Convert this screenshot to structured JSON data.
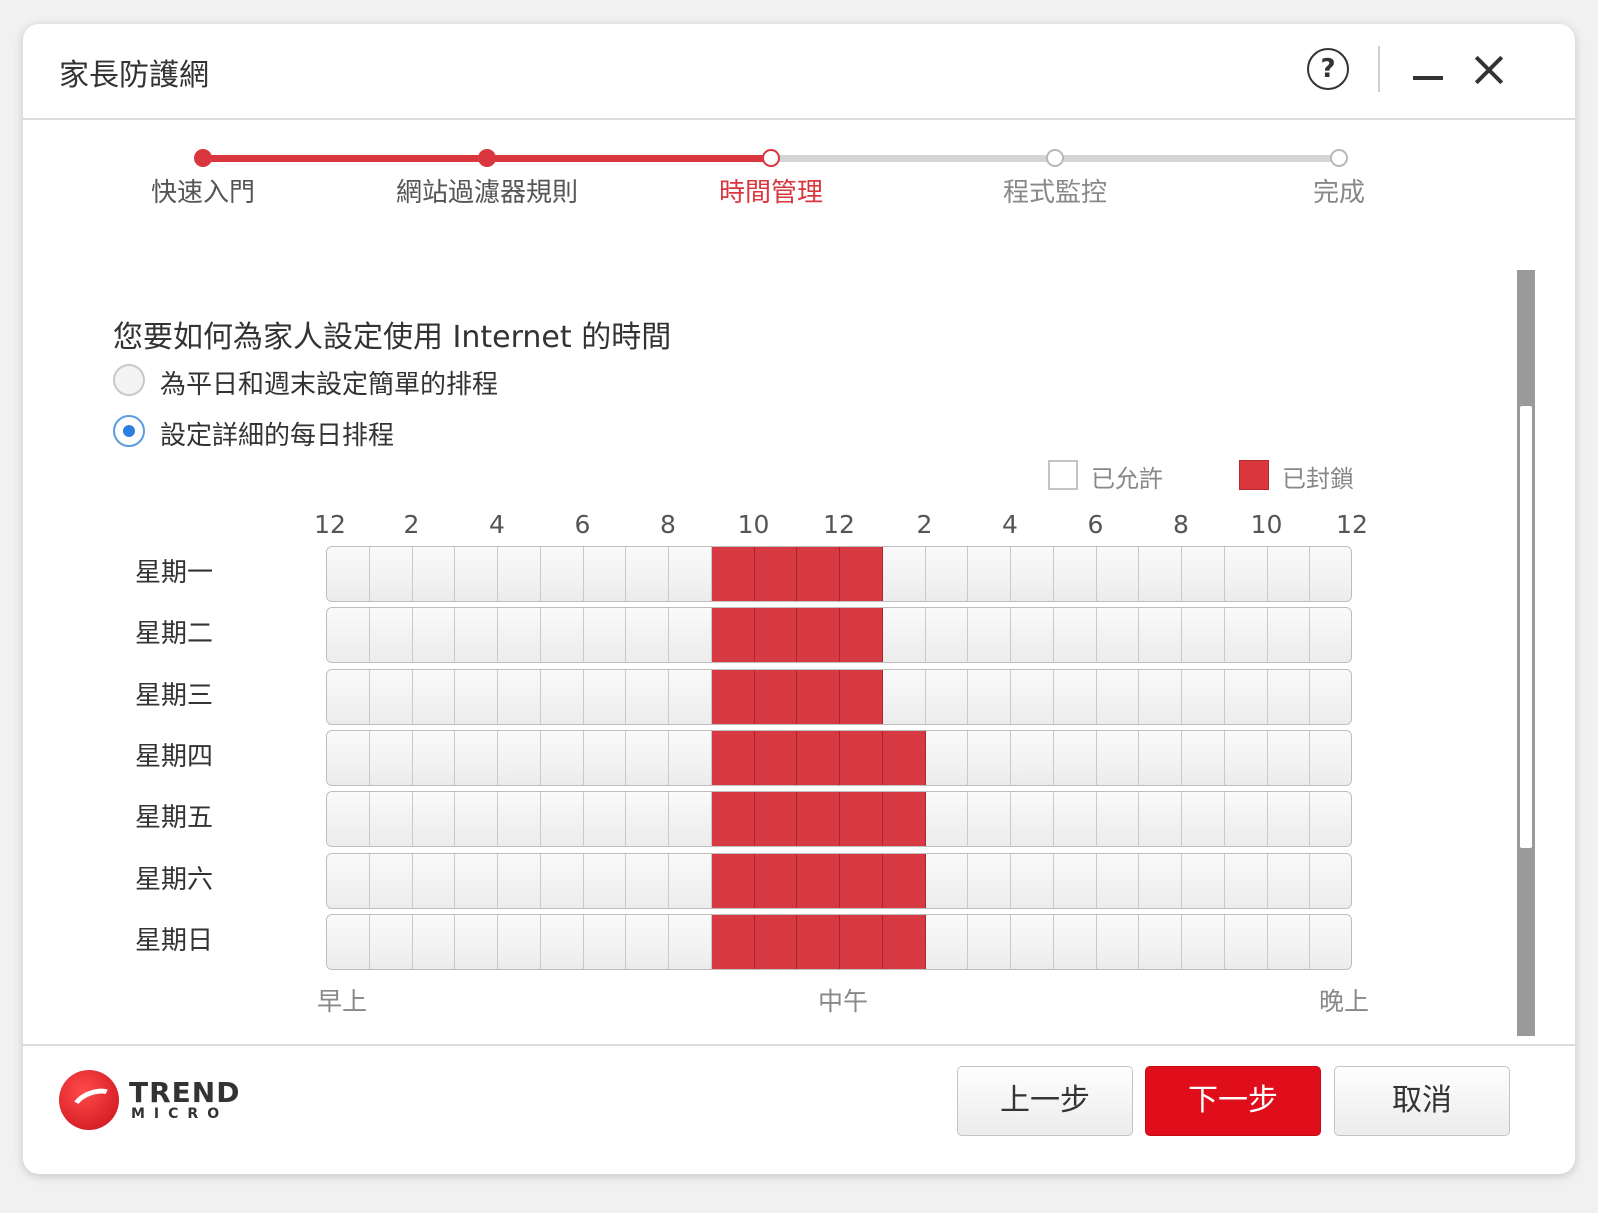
{
  "window": {
    "title": "家長防護網"
  },
  "stepper": {
    "steps": [
      {
        "label": "快速入門",
        "state": "done"
      },
      {
        "label": "網站過濾器規則",
        "state": "done"
      },
      {
        "label": "時間管理",
        "state": "current"
      },
      {
        "label": "程式監控",
        "state": "todo"
      },
      {
        "label": "完成",
        "state": "todo"
      }
    ]
  },
  "main": {
    "question": "您要如何為家人設定使用 Internet 的時間",
    "options": [
      {
        "label": "為平日和週末設定簡單的排程",
        "checked": false
      },
      {
        "label": "設定詳細的每日排程",
        "checked": true
      }
    ]
  },
  "legend": {
    "allowed": "已允許",
    "blocked": "已封鎖"
  },
  "schedule": {
    "hour_labels": [
      "12",
      "2",
      "4",
      "6",
      "8",
      "10",
      "12",
      "2",
      "4",
      "6",
      "8",
      "10",
      "12"
    ],
    "period_labels": {
      "morning": "早上",
      "noon": "中午",
      "evening": "晚上"
    },
    "days": [
      {
        "name": "星期一",
        "blocked_slots": [
          9,
          10,
          11,
          12
        ]
      },
      {
        "name": "星期二",
        "blocked_slots": [
          9,
          10,
          11,
          12
        ]
      },
      {
        "name": "星期三",
        "blocked_slots": [
          9,
          10,
          11,
          12
        ]
      },
      {
        "name": "星期四",
        "blocked_slots": [
          9,
          10,
          11,
          12,
          13
        ]
      },
      {
        "name": "星期五",
        "blocked_slots": [
          9,
          10,
          11,
          12,
          13
        ]
      },
      {
        "name": "星期六",
        "blocked_slots": [
          9,
          10,
          11,
          12,
          13
        ]
      },
      {
        "name": "星期日",
        "blocked_slots": [
          9,
          10,
          11,
          12,
          13
        ]
      }
    ],
    "slots_per_day": 24
  },
  "footer": {
    "logo_brand": "TREND",
    "logo_sub": "MICRO",
    "back_label": "上一步",
    "next_label": "下一步",
    "cancel_label": "取消"
  },
  "colors": {
    "accent": "#d9363e",
    "primary_button": "#e00d1a",
    "radio_checked": "#2d7fe0"
  }
}
